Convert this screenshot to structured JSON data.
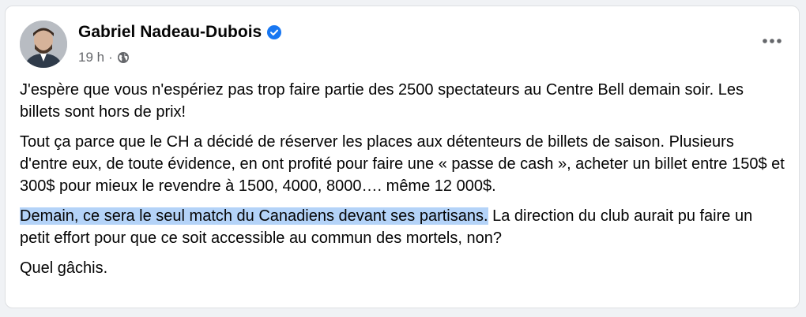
{
  "post": {
    "author_name": "Gabriel Nadeau-Dubois",
    "time": "19 h",
    "separator": "·",
    "verified_icon": "verified-badge-icon",
    "privacy_icon": "globe-icon",
    "more_icon": "more-options-icon",
    "paragraphs": [
      "J'espère que vous n'espériez pas trop faire partie des 2500 spectateurs au Centre Bell demain soir. Les billets sont hors de prix!",
      "Tout ça parce que le CH a décidé de réserver les places aux détenteurs de billets de saison. Plusieurs d'entre eux, de toute évidence, en ont profité pour faire une « passe de cash », acheter un billet entre 150$ et 300$ pour mieux le revendre à 1500, 4000, 8000…. même 12 000$."
    ],
    "highlight_paragraph": {
      "highlighted": "Demain, ce sera le seul match du Canadiens devant ses partisans.",
      "rest": " La direction du club aurait pu faire un petit effort pour que ce soit accessible au commun des mortels, non?"
    },
    "last_paragraph": "Quel gâchis."
  },
  "colors": {
    "verified_blue": "#1877f2",
    "highlight": "#b4d3f8",
    "secondary_text": "#65676b"
  }
}
